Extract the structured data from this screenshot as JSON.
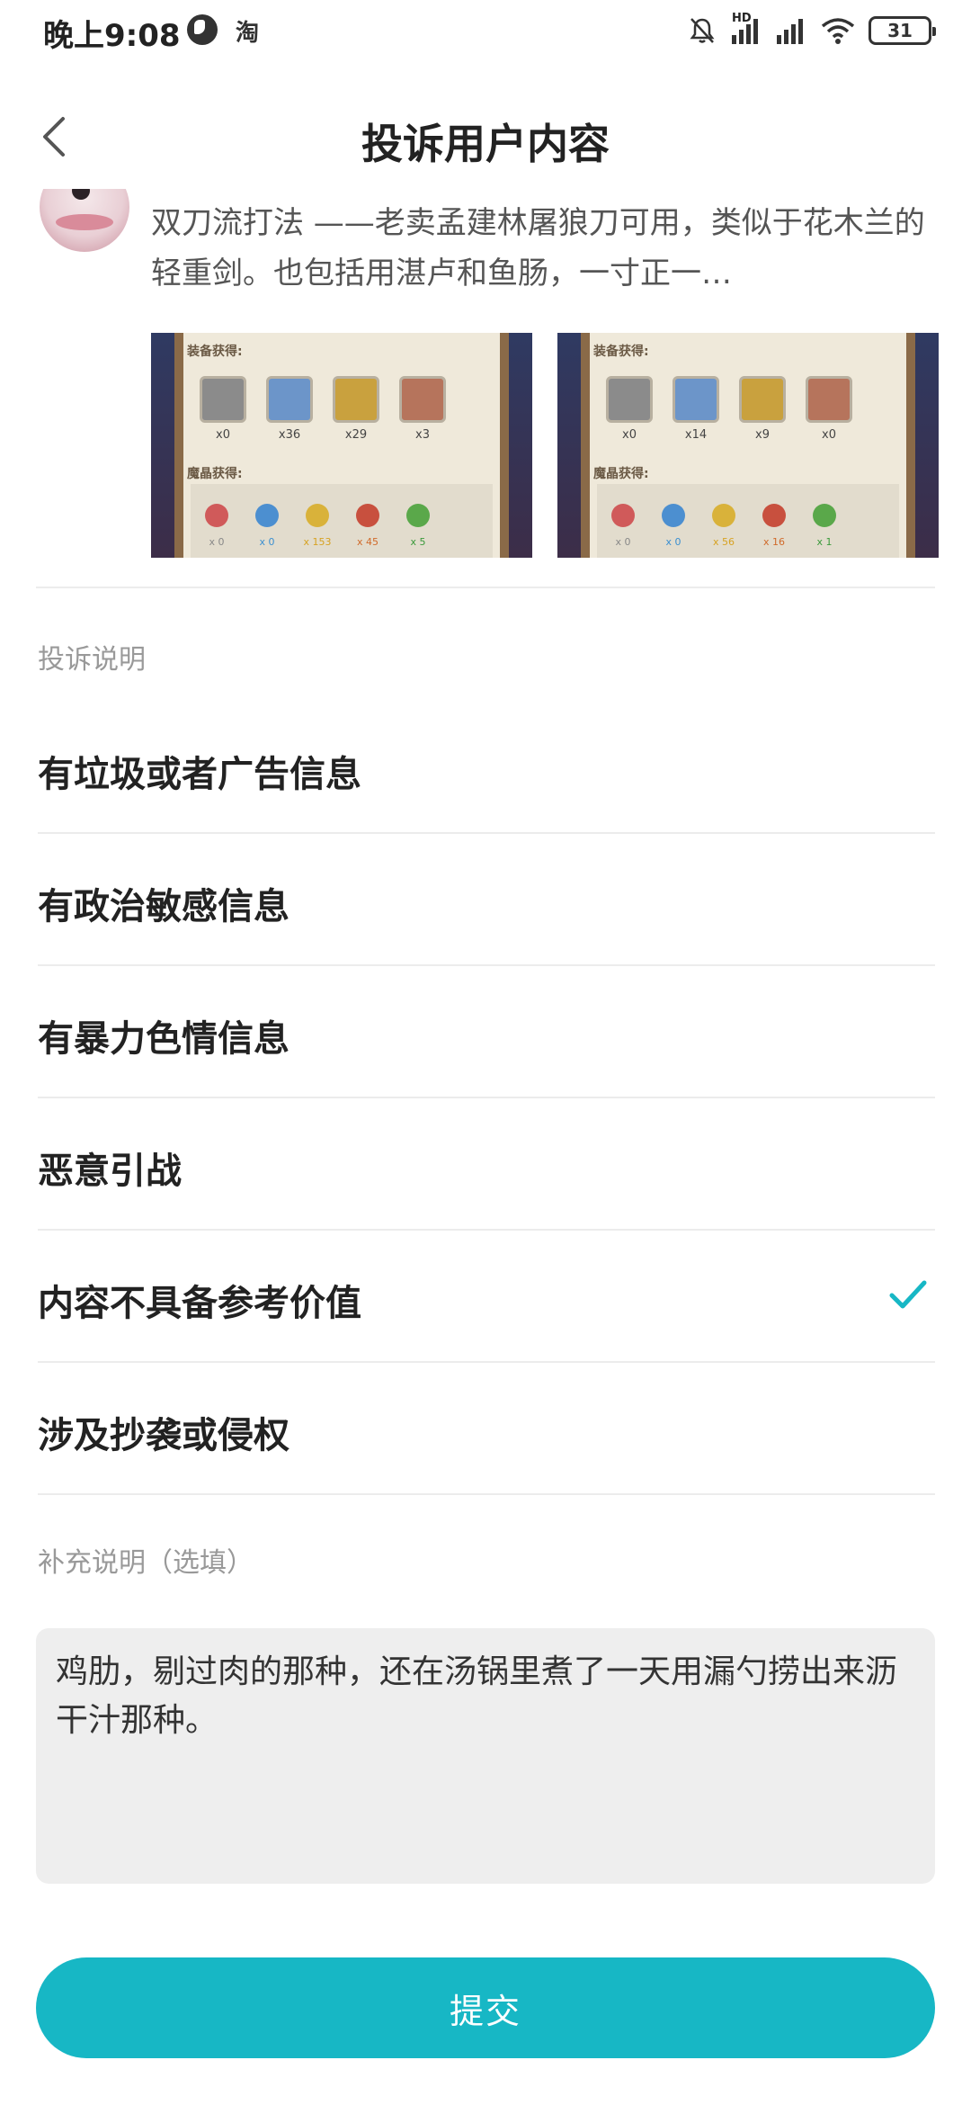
{
  "status_bar": {
    "time": "晚上9:08",
    "app_icon": "淘",
    "network": "HD",
    "battery": "31"
  },
  "header": {
    "title": "投诉用户内容"
  },
  "post": {
    "text": "双刀流打法 ——老卖孟建林屠狼刀可用，类似于花木兰的轻重剑。也包括用湛卢和鱼肠，一寸正一…",
    "images": [
      {
        "equip_label": "装备获得:",
        "crystal_label": "魔晶获得:",
        "chest_counts": [
          "x0",
          "x36",
          "x29",
          "x3"
        ],
        "crystal_counts": [
          "x 0",
          "x 0",
          "x 153",
          "x 45",
          "x 5"
        ]
      },
      {
        "equip_label": "装备获得:",
        "crystal_label": "魔晶获得:",
        "chest_counts": [
          "x0",
          "x14",
          "x9",
          "x0"
        ],
        "crystal_counts": [
          "x 0",
          "x 0",
          "x 56",
          "x 16",
          "x 1"
        ]
      }
    ]
  },
  "complaint": {
    "section_label": "投诉说明",
    "options": [
      {
        "label": "有垃圾或者广告信息",
        "selected": false
      },
      {
        "label": "有政治敏感信息",
        "selected": false
      },
      {
        "label": "有暴力色情信息",
        "selected": false
      },
      {
        "label": "恶意引战",
        "selected": false
      },
      {
        "label": "内容不具备参考价值",
        "selected": true
      },
      {
        "label": "涉及抄袭或侵权",
        "selected": false
      }
    ]
  },
  "supplement": {
    "label": "补充说明（选填）",
    "value": "鸡肋，剔过肉的那种，还在汤锅里煮了一天用漏勺捞出来沥干汁那种。"
  },
  "submit_label": "提交",
  "colors": {
    "accent": "#17b7c5",
    "divider": "#ececec",
    "muted_text": "#999999"
  }
}
